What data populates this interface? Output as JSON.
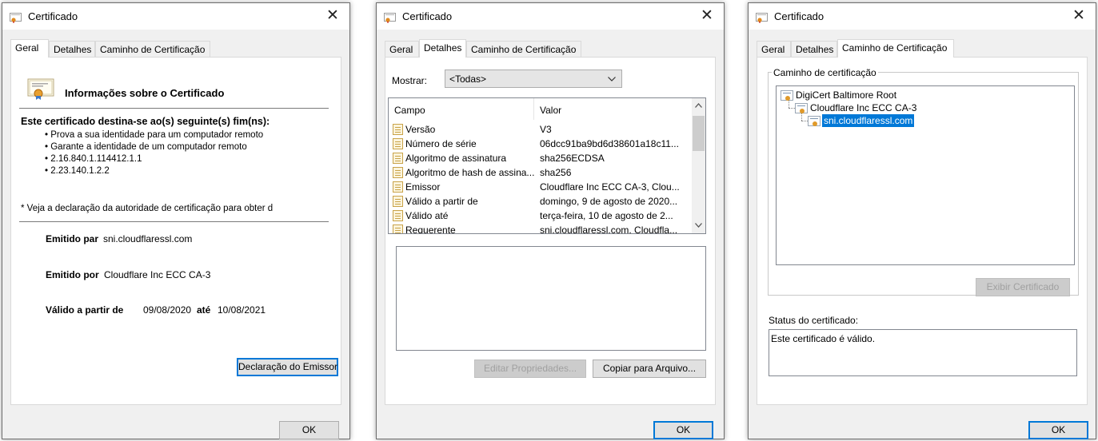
{
  "dialogs": [
    {
      "title": "Certificado",
      "tabs": [
        "Geral",
        "Detalhes",
        "Caminho de Certificação"
      ],
      "heading": "Informações sobre o Certificado",
      "purpose_title": "Este certificado destina-se ao(s) seguinte(s) fim(ns):",
      "purposes": [
        "Prova a sua identidade para um computador remoto",
        "Garante a identidade de um computador remoto",
        "2.16.840.1.114412.1.1",
        "2.23.140.1.2.2"
      ],
      "note": "* Veja a declaração da autoridade de certificação para obter d",
      "issued_to_label": "Emitido par",
      "issued_to": "sni.cloudflaressl.com",
      "issued_by_label": "Emitido por",
      "issued_by": "Cloudflare Inc ECC CA-3",
      "valid_from_label": "Válido a partir de",
      "valid_from": "09/08/2020",
      "valid_until_label": "até",
      "valid_until": "10/08/2021",
      "issuer_statement_button": "Declaração do Emissor",
      "ok_button": "OK"
    },
    {
      "title": "Certificado",
      "tabs": [
        "Geral",
        "Detalhes",
        "Caminho de Certificação"
      ],
      "show_label": "Mostrar:",
      "show_value": "<Todas>",
      "columns": [
        "Campo",
        "Valor"
      ],
      "fields": [
        {
          "field": "Versão",
          "value": "V3"
        },
        {
          "field": "Número de série",
          "value": "06dcc91ba9bd6d38601a18c11..."
        },
        {
          "field": "Algoritmo de assinatura",
          "value": "sha256ECDSA"
        },
        {
          "field": "Algoritmo de hash de assina...",
          "value": "sha256"
        },
        {
          "field": "Emissor",
          "value": "Cloudflare Inc ECC CA-3, Clou..."
        },
        {
          "field": "Válido a partir de",
          "value": "domingo, 9 de agosto de 2020..."
        },
        {
          "field": "Válido até",
          "value": "terça-feira, 10 de agosto de 2..."
        },
        {
          "field": "Requerente",
          "value": "sni.cloudflaressl.com, Cloudfla..."
        }
      ],
      "edit_properties_button": "Editar Propriedades...",
      "copy_to_file_button": "Copiar para Arquivo...",
      "ok_button": "OK"
    },
    {
      "title": "Certificado",
      "tabs": [
        "Geral",
        "Detalhes",
        "Caminho de Certificação"
      ],
      "path_group_label": "Caminho de certificação",
      "path": [
        "DigiCert Baltimore Root",
        "Cloudflare Inc ECC CA-3",
        "sni.cloudflaressl.com"
      ],
      "view_certificate_button": "Exibir Certificado",
      "status_label": "Status do certificado:",
      "status_text": "Este certificado é válido.",
      "ok_button": "OK"
    }
  ],
  "colors": {
    "selection": "#0078d7",
    "dialog_bg": "#f0f0f0",
    "focus_border": "#0078d7"
  }
}
